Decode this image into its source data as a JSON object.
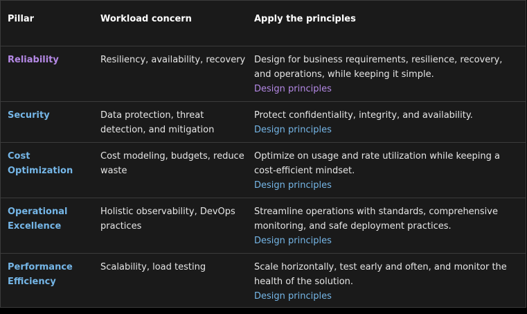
{
  "headers": {
    "pillar": "Pillar",
    "concern": "Workload concern",
    "apply": "Apply the principles"
  },
  "rows": [
    {
      "pillar": "Reliability",
      "concern": "Resiliency, availability, recovery",
      "apply": "Design for business requirements, resilience, recovery, and operations, while keeping it simple.",
      "link": "Design principles",
      "visited": true
    },
    {
      "pillar": "Security",
      "concern": "Data protection, threat detection, and mitigation",
      "apply": "Protect confidentiality, integrity, and availability.",
      "link": "Design principles",
      "visited": false
    },
    {
      "pillar": "Cost Optimization",
      "concern": "Cost modeling, budgets, reduce waste",
      "apply": "Optimize on usage and rate utilization while keeping a cost-efficient mindset.",
      "link": "Design principles",
      "visited": false
    },
    {
      "pillar": "Operational Excellence",
      "concern": "Holistic observability, DevOps practices",
      "apply": "Streamline operations with standards, comprehensive monitoring, and safe deployment practices.",
      "link": "Design principles",
      "visited": false
    },
    {
      "pillar": "Performance Efficiency",
      "concern": "Scalability, load testing",
      "apply": "Scale horizontally, test early and often, and monitor the health of the solution.",
      "link": "Design principles",
      "visited": false
    }
  ],
  "colors": {
    "link": "#75b6e7",
    "visited_link": "#b589e6",
    "background": "#1a1a1a",
    "border": "#3b3b3b"
  }
}
